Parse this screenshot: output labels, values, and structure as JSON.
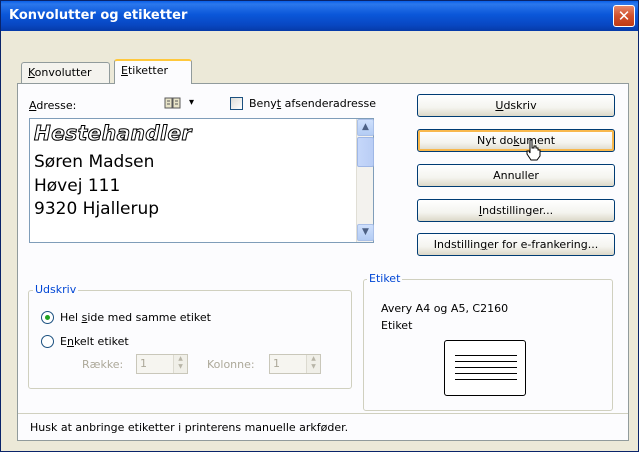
{
  "window": {
    "title": "Konvolutter og etiketter",
    "close_glyph": "✕"
  },
  "tabs": [
    {
      "label": "Konvolutter",
      "accesskey": "K",
      "rest": "onvolutter"
    },
    {
      "label": "Etiketter",
      "accesskey": "E",
      "rest": "tiketter"
    }
  ],
  "address": {
    "label_pre": "",
    "label_key": "A",
    "label_post": "dresse:",
    "book_menu_glyph": "▾",
    "lines": [
      "Hestehandler",
      "Søren Madsen",
      "Høvej 111",
      "9320 Hjallerup"
    ],
    "use_return_pre": "Beny",
    "use_return_key": "t",
    "use_return_post": " afsenderadresse"
  },
  "buttons": {
    "print": {
      "pre": "",
      "key": "U",
      "post": "dskriv"
    },
    "new_document": {
      "pre": "Nyt do",
      "key": "k",
      "post": "ument"
    },
    "cancel": {
      "label": "Annuller"
    },
    "options": {
      "pre": "",
      "key": "I",
      "post": "ndstillinger..."
    },
    "epostage": {
      "pre": "Indstillin",
      "key": "g",
      "post": "er for e-frankering..."
    }
  },
  "print_group": {
    "title": "Udskriv",
    "full_page_pre": "Hel ",
    "full_page_key": "s",
    "full_page_post": "ide med samme etiket",
    "single_pre": "E",
    "single_key": "n",
    "single_post": "kelt etiket",
    "row_label": "Række:",
    "row_value": "1",
    "column_label": "Kolonne:",
    "column_value": "1"
  },
  "label_group": {
    "title": "Etiket",
    "product": "Avery A4 og A5, C2160",
    "type": "Etiket"
  },
  "footer": {
    "hint": "Husk at anbringe etiketter i printerens manuelle arkføder."
  },
  "colors": {
    "title_bar": "#0b57d9",
    "group_title": "#0046d5",
    "focus_border": "#f8b84c"
  }
}
